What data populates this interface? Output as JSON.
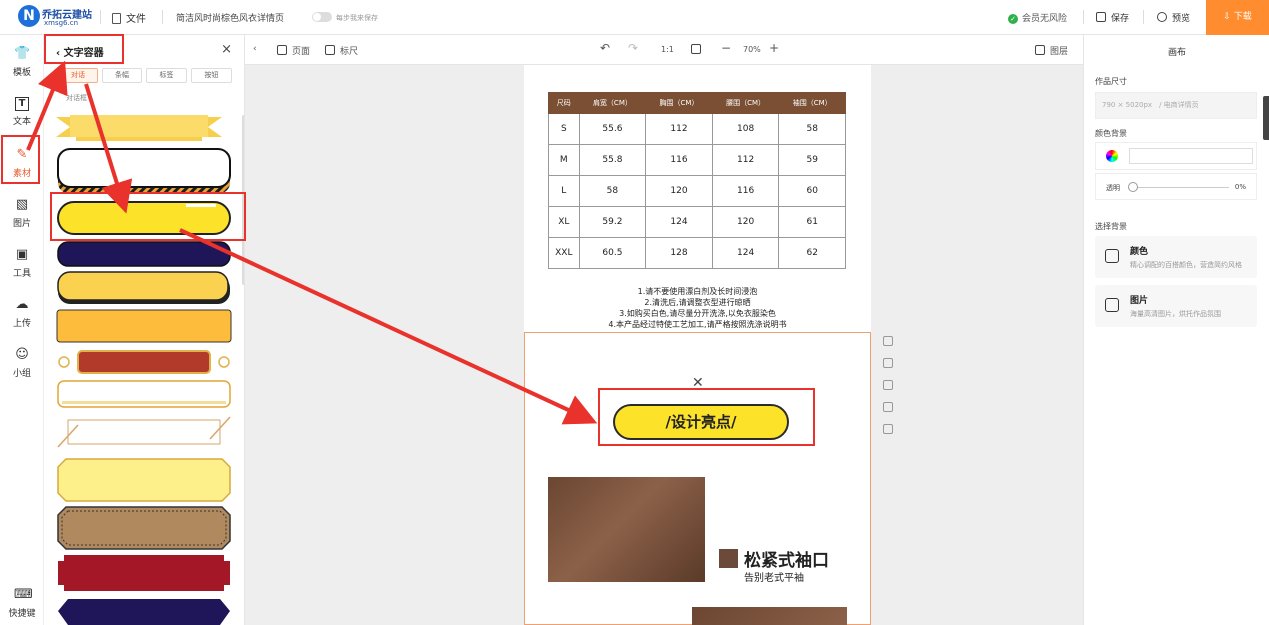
{
  "topbar": {
    "brand_name": "乔拓云建站",
    "brand_domain": "xmsg6.cn",
    "logo_letter": "N",
    "file_label": "文件",
    "doc_title": "简洁风时尚棕色风衣详情页",
    "sync_label": "每步我来保存",
    "member_label": "会员无风险",
    "save_label": "保存",
    "preview_label": "预览",
    "download_label": "下载"
  },
  "iconbar": {
    "items": [
      {
        "label": "模板",
        "glyph": "👕"
      },
      {
        "label": "文本",
        "glyph": "T"
      },
      {
        "label": "素材",
        "glyph": "✎"
      },
      {
        "label": "图片",
        "glyph": "▧"
      },
      {
        "label": "工具",
        "glyph": "▣"
      },
      {
        "label": "上传",
        "glyph": "☁"
      },
      {
        "label": "小组",
        "glyph": "☺"
      }
    ],
    "shortcut_label": "快捷键",
    "shortcut_glyph": "⌨"
  },
  "panel": {
    "title": "文字容器",
    "back_glyph": "‹",
    "close_glyph": "×",
    "tabs": [
      {
        "label": "对话",
        "active": true
      },
      {
        "label": "条幅",
        "active": false
      },
      {
        "label": "标签",
        "active": false
      },
      {
        "label": "按钮",
        "active": false
      }
    ],
    "sub_label": "对话框"
  },
  "canvas_toolbar": {
    "page_label": "页面",
    "ruler_label": "标尺",
    "undo_glyph": "↶",
    "redo_glyph": "↷",
    "ratio_label": "1:1",
    "zoom_out": "−",
    "zoom_value": "70%",
    "zoom_in": "+",
    "layers_label": "图层"
  },
  "size_table": {
    "headers": [
      "尺码",
      "肩宽（CM）",
      "胸围（CM）",
      "腰围（CM）",
      "袖围（CM）"
    ],
    "rows": [
      [
        "S",
        "55.6",
        "112",
        "108",
        "58"
      ],
      [
        "M",
        "55.8",
        "116",
        "112",
        "59"
      ],
      [
        "L",
        "58",
        "120",
        "116",
        "60"
      ],
      [
        "XL",
        "59.2",
        "124",
        "120",
        "61"
      ],
      [
        "XXL",
        "60.5",
        "128",
        "124",
        "62"
      ]
    ]
  },
  "notes": [
    "1.请不要使用漂白剂及长时间浸泡",
    "2.清洗后,请调整衣型进行晾晒",
    "3.如购买白色,请尽量分开洗涤,以免衣服染色",
    "4.本产品经过特使工艺加工,请严格按照洗涤说明书"
  ],
  "design_button_text": "/设计亮点/",
  "feature": {
    "title": "松紧式袖口",
    "subtitle": "告别老式平袖"
  },
  "right_panel": {
    "title": "画布",
    "size_label": "作品尺寸",
    "size_value": "790 × 5020px　/ 电商详情页",
    "color_bg_label": "颜色背景",
    "opacity_label": "透明",
    "opacity_value": "0%",
    "select_bg_label": "选择背景",
    "card_color_title": "颜色",
    "card_color_desc": "精心调配的百搭颜色，营造简约风格",
    "card_image_title": "图片",
    "card_image_desc": "海量高清图片，烘托作品氛围"
  },
  "colors": {
    "accent_orange": "#ff8c2f",
    "brand_brown": "#7a4f34",
    "button_yellow": "#fce329",
    "annotation_red": "#e8322b"
  }
}
